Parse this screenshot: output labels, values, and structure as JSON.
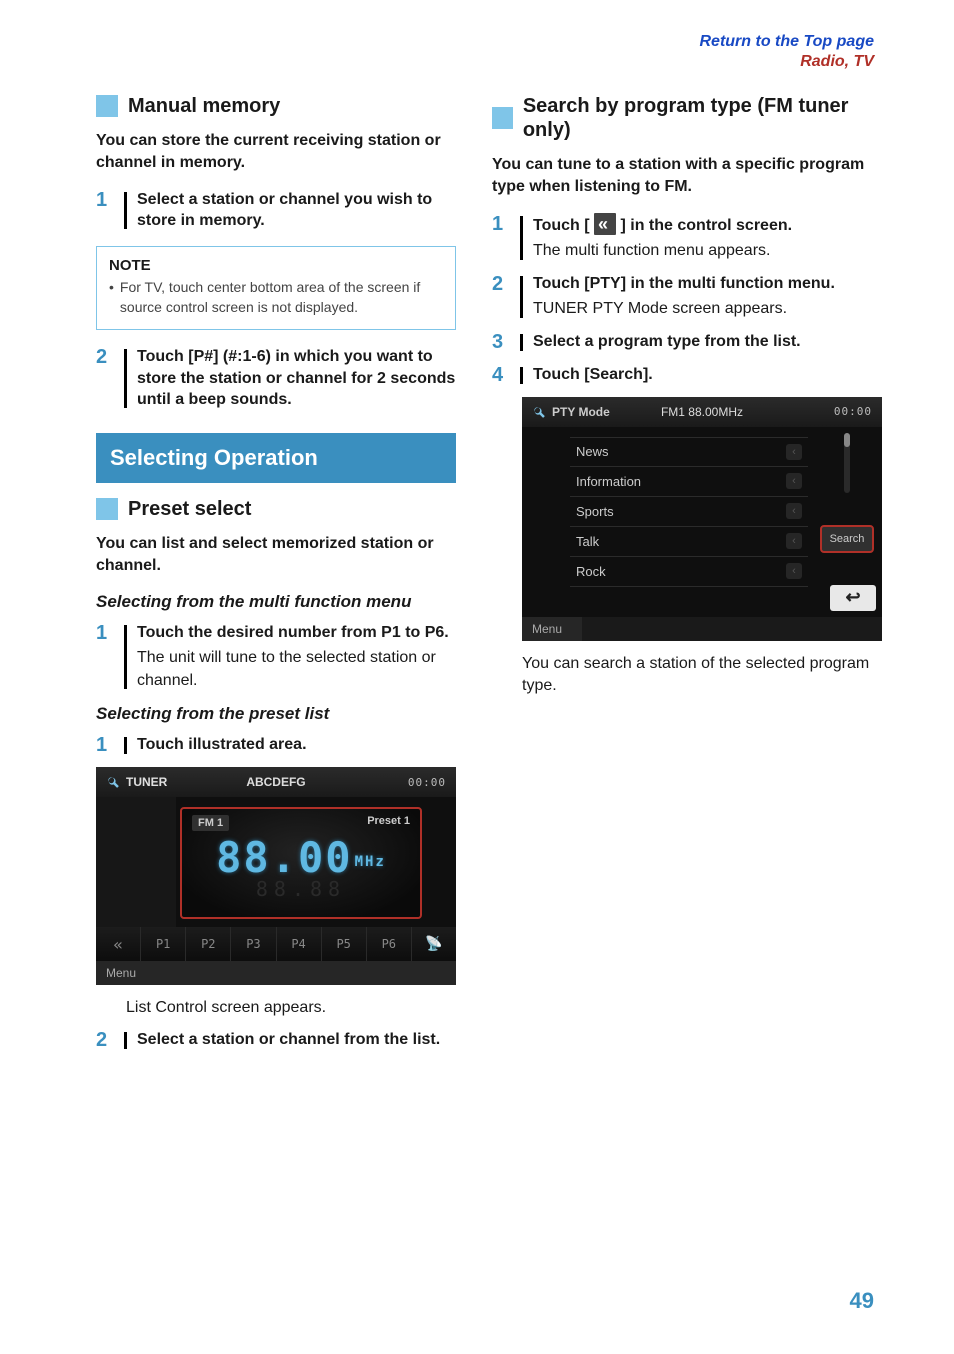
{
  "top_link_1": "Return to the Top page",
  "top_link_2": "Radio, TV",
  "left": {
    "manual_memory": {
      "heading": "Manual memory",
      "intro": "You can store the current receiving station or channel in memory.",
      "step1": "Select a station or channel you wish to store in memory.",
      "note_title": "NOTE",
      "note_1": "For TV, touch center bottom area of the screen if source control screen is not displayed.",
      "step2": "Touch [P#] (#:1-6) in which you want to store the station or channel for 2 seconds until a beep sounds."
    },
    "selecting_operation": "Selecting Operation",
    "preset_select": {
      "heading": "Preset select",
      "intro": "You can list and select memorized station or channel.",
      "sub1": "Selecting from the multi function menu",
      "s1_step1": "Touch the desired number from P1 to P6.",
      "s1_step1_plain": "The unit will tune to the selected station or channel.",
      "sub2": "Selecting from the preset list",
      "s2_step1": "Touch illustrated area.",
      "screenshot1": {
        "title_left": "TUNER",
        "title_mid": "ABCDEFG",
        "clock": "00:00",
        "band": "FM 1",
        "preset": "Preset 1",
        "freq": "88.00",
        "freq_unit": "MHz",
        "presets": [
          "P1",
          "P2",
          "P3",
          "P4",
          "P5",
          "P6"
        ],
        "menu": "Menu"
      },
      "caption1": "List Control screen appears.",
      "s2_step2": "Select a station or channel from the list."
    }
  },
  "right": {
    "search_pty": {
      "heading": "Search by program type (FM tuner only)",
      "intro": "You can tune to a station with a specific program type when listening to FM.",
      "step1_a": "Touch [",
      "step1_b": "] in the control screen.",
      "step1_plain": "The multi function menu appears.",
      "step2": "Touch [PTY] in the multi function menu.",
      "step2_plain": "TUNER PTY Mode screen appears.",
      "step3": "Select a program type from the list.",
      "step4": "Touch [Search].",
      "screenshot2": {
        "title_left": "PTY Mode",
        "title_mid": "FM1 88.00MHz",
        "clock": "00:00",
        "items": [
          "News",
          "Information",
          "Sports",
          "Talk",
          "Rock"
        ],
        "search": "Search",
        "menu": "Menu"
      },
      "caption2": "You can search a station of the selected program type."
    }
  },
  "page_number": "49"
}
